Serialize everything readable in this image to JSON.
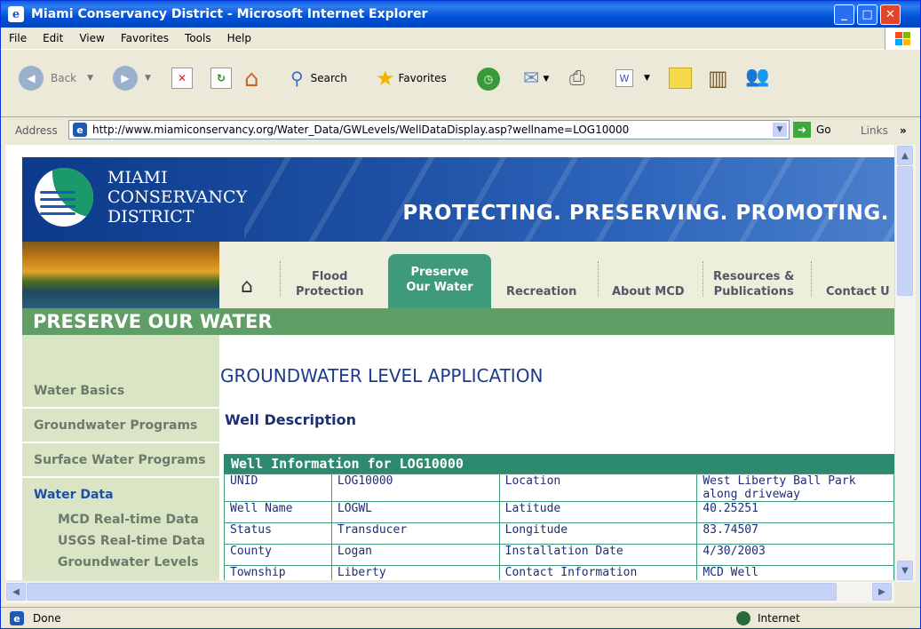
{
  "window": {
    "title": "Miami Conservancy District - Microsoft Internet Explorer"
  },
  "menu": [
    "File",
    "Edit",
    "View",
    "Favorites",
    "Tools",
    "Help"
  ],
  "toolbar": {
    "back": "Back",
    "search": "Search",
    "favorites": "Favorites"
  },
  "address": {
    "label": "Address",
    "url": "http://www.miamiconservancy.org/Water_Data/GWLevels/WellDataDisplay.asp?wellname=LOG10000",
    "go": "Go",
    "links": "Links"
  },
  "site": {
    "brand_line1": "MIAMI",
    "brand_line2": "CONSERVANCY",
    "brand_line3": "DISTRICT",
    "tagline": "PROTECTING. PRESERVING. PROMOTING.",
    "nav": {
      "flood1": "Flood",
      "flood2": "Protection",
      "preserve1": "Preserve",
      "preserve2": "Our Water",
      "recreation": "Recreation",
      "about": "About MCD",
      "res1": "Resources &",
      "res2": "Publications",
      "contact": "Contact U"
    },
    "section": "PRESERVE OUR WATER",
    "sidebar": {
      "water_basics": "Water Basics",
      "groundwater_programs": "Groundwater Programs",
      "surface_water_programs": "Surface Water Programs",
      "water_data": "Water Data",
      "mcd_realtime": "MCD Real-time Data",
      "usgs_realtime": "USGS Real-time Data",
      "gw_levels": "Groundwater Levels"
    },
    "page_title": "GROUNDWATER LEVEL APPLICATION",
    "well_description": "Well Description",
    "table_title": "Well Information for  LOG10000",
    "rows": [
      [
        "UNID",
        "LOG10000",
        "Location",
        "West Liberty Ball Park along driveway"
      ],
      [
        "Well Name",
        "LOGWL",
        "Latitude",
        "40.25251"
      ],
      [
        "Status",
        "Transducer",
        "Longitude",
        "83.74507"
      ],
      [
        "County",
        "Logan",
        "Installation Date",
        "4/30/2003"
      ],
      [
        "Township",
        "Liberty",
        "Contact Information",
        "MCD Well"
      ]
    ]
  },
  "status": {
    "left": "Done",
    "zone": "Internet"
  }
}
